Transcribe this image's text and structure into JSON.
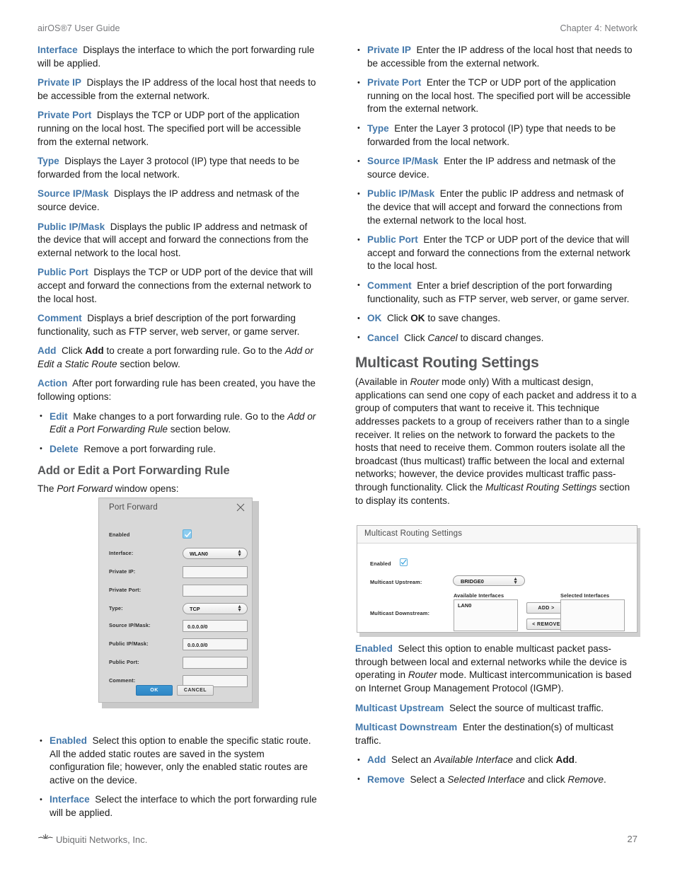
{
  "header": {
    "left": "airOS®7 User Guide",
    "right": "Chapter 4: Network"
  },
  "footer": {
    "company": "Ubiquiti Networks, Inc.",
    "page_number": "27",
    "logo": "ubiquiti-spark-logo"
  },
  "colors": {
    "term_blue": "#4378ab",
    "heading_gray": "#58595b",
    "running_head_gray": "#77787b",
    "body_black": "#1b1b1b",
    "ok_button_blue": "#3187c8",
    "checkbox_blue": "#8dcdf0"
  },
  "left_column": {
    "definitions": [
      {
        "term": "Interface",
        "text": "Displays the interface to which the port forwarding rule will be applied."
      },
      {
        "term": "Private IP",
        "text": "Displays the IP address of the local host that needs to be accessible from the external network."
      },
      {
        "term": "Private Port",
        "text": "Displays the TCP or UDP port of the application running on the local host. The specified port will be accessible from the external network."
      },
      {
        "term": "Type",
        "text": "Displays the Layer 3 protocol (IP) type that needs to be forwarded from the local network."
      },
      {
        "term": "Source IP/Mask",
        "text": "Displays the IP address and netmask of the source device."
      },
      {
        "term": "Public IP/Mask",
        "text": "Displays the public IP address and netmask of the device that will accept and forward the connections from the external network to the local host."
      },
      {
        "term": "Public Port",
        "text": "Displays the TCP or UDP port of the device that will accept and forward the connections from the external network to the local host."
      },
      {
        "term": "Comment",
        "text": "Displays a brief description of the port forwarding functionality, such as FTP server, web server, or game server."
      }
    ],
    "add_entry": {
      "term": "Add",
      "pre": "Click ",
      "bold": "Add",
      "mid": " to create a port forwarding rule. Go to the ",
      "italic": "Add or Edit a Static Route",
      "post": " section below."
    },
    "action_entry": {
      "term": "Action",
      "text": "After port forwarding rule has been created, you have the following options:"
    },
    "action_bullets": [
      {
        "term": "Edit",
        "pre": "Make changes to a port forwarding rule. Go to the ",
        "italic": "Add or Edit a Port Forwarding Rule",
        "post": " section below."
      },
      {
        "term": "Delete",
        "pre": "Remove a port forwarding rule.",
        "italic": "",
        "post": ""
      }
    ],
    "section_heading": "Add or Edit a Port Forwarding Rule",
    "section_intro": {
      "pre": "The ",
      "italic": "Port Forward",
      "post": " window opens:"
    },
    "post_figure_bullets": [
      {
        "term": "Enabled",
        "text": "Select this option to enable the specific static route. All the added static routes are saved in the system configuration file; however, only the enabled static routes are active on the device."
      },
      {
        "term": "Interface",
        "text": "Select the interface to which the port forwarding rule will be applied."
      }
    ]
  },
  "right_column": {
    "bullets": [
      {
        "term": "Private IP",
        "text": "Enter the IP address of the local host that needs to be accessible from the external network."
      },
      {
        "term": "Private Port",
        "text": "Enter the TCP or UDP port of the application running on the local host. The specified port will be accessible from the external network."
      },
      {
        "term": "Type",
        "text": "Enter the Layer 3 protocol (IP) type that needs to be forwarded from the local network."
      },
      {
        "term": "Source IP/Mask",
        "text": "Enter the IP address and netmask of the source device."
      },
      {
        "term": "Public IP/Mask",
        "text": "Enter the public IP address and netmask of the device that will accept and forward the connections from the external network to the local host."
      },
      {
        "term": "Public Port",
        "text": "Enter the TCP or UDP port of the device that will accept and forward the connections from the external network to the local host."
      },
      {
        "term": "Comment",
        "text": "Enter a brief description of the port forwarding functionality, such as FTP server, web server, or game server."
      }
    ],
    "ok_bullet": {
      "term": "OK",
      "pre": "Click ",
      "bold": "OK",
      "post": " to save changes."
    },
    "cancel_bullet": {
      "term": "Cancel",
      "pre": "Click ",
      "italic": "Cancel",
      "post": " to discard changes."
    },
    "section_heading": "Multicast Routing Settings",
    "intro": {
      "p1": "(Available in ",
      "i1": "Router",
      "p2": " mode only) With a multicast design, applications can send one copy of each packet and address it to a group of computers that want to receive it. This technique addresses packets to a group of receivers rather than to a single receiver. It relies on the network to forward the packets to the hosts that need to receive them. Common routers isolate all the broadcast (thus multicast) traffic between the local and external networks; however, the device provides multicast traffic pass-through functionality. Click the ",
      "i2": "Multicast Routing Settings",
      "p3": " section to display its contents."
    },
    "post_figure": {
      "enabled": {
        "term": "Enabled",
        "p1": "Select this option to enable multicast packet pass-through between local and external networks while the device is operating in ",
        "i1": "Router",
        "p2": " mode. Multicast intercommunication is based on Internet Group Management Protocol (IGMP)."
      },
      "upstream": {
        "term": "Multicast Upstream",
        "text": "Select the source of multicast traffic."
      },
      "downstream": {
        "term": "Multicast Downstream",
        "text": "Enter the destination(s) of multicast traffic."
      },
      "add_bullet": {
        "term": "Add",
        "pre": "Select an ",
        "italic": "Available Interface",
        "mid": " and click ",
        "bold": "Add",
        "post": "."
      },
      "remove_bullet": {
        "term": "Remove",
        "pre": "Select a ",
        "italic": "Selected Interface",
        "mid": " and click ",
        "italic2": "Remove",
        "post": "."
      }
    }
  },
  "port_forward_dialog": {
    "title": "Port Forward",
    "close_icon": "close-x-icon",
    "fields": [
      {
        "label": "Enabled",
        "type": "checkbox",
        "value": "checked"
      },
      {
        "label": "Interface:",
        "type": "select",
        "value": "WLAN0"
      },
      {
        "label": "Private IP:",
        "type": "text",
        "value": ""
      },
      {
        "label": "Private Port:",
        "type": "text",
        "value": ""
      },
      {
        "label": "Type:",
        "type": "select",
        "value": "TCP"
      },
      {
        "label": "Source IP/Mask:",
        "type": "text",
        "value": "0.0.0.0/0"
      },
      {
        "label": "Public IP/Mask:",
        "type": "text",
        "value": "0.0.0.0/0"
      },
      {
        "label": "Public Port:",
        "type": "text",
        "value": ""
      },
      {
        "label": "Comment:",
        "type": "text",
        "value": ""
      }
    ],
    "ok_label": "OK",
    "cancel_label": "CANCEL"
  },
  "multicast_panel": {
    "title": "Multicast Routing Settings",
    "enabled_label": "Enabled",
    "enabled_value": "checked",
    "upstream_label": "Multicast Upstream:",
    "upstream_value": "BRIDGE0",
    "downstream_label": "Multicast Downstream:",
    "available_header": "Available Interfaces",
    "available_items": "LAN0",
    "selected_header": "Selected Interfaces",
    "selected_items": "",
    "add_button": "ADD >",
    "remove_button": "< REMOVE"
  }
}
